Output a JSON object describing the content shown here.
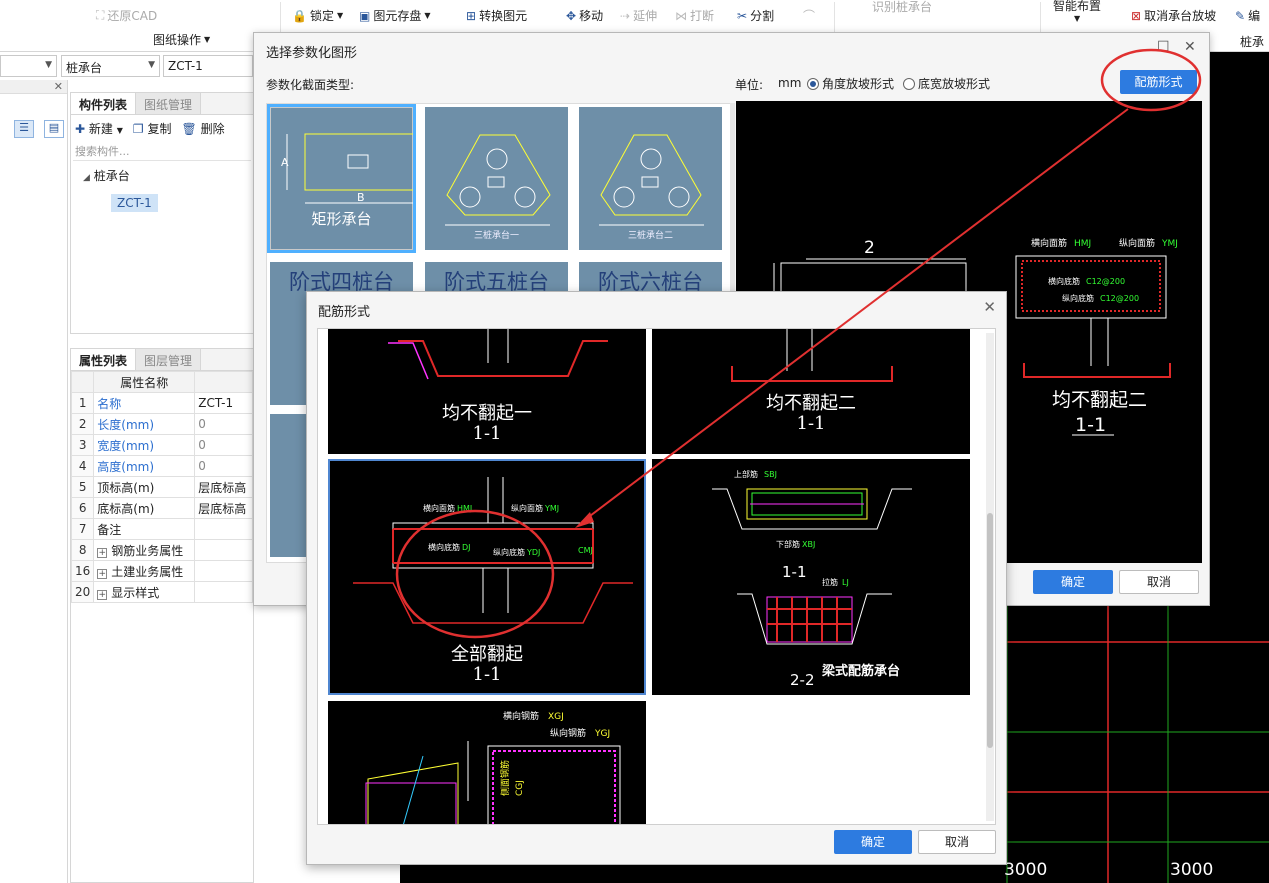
{
  "ribbon": {
    "restore_cad": "还原CAD",
    "drawing_ops": "图纸操作",
    "lock": "锁定",
    "element_save": "图元存盘",
    "convert_element": "转换图元",
    "move": "移动",
    "extend": "延伸",
    "break": "打断",
    "split": "分割",
    "identify_pile_cap": "识别桩承台",
    "smart_layout": "智能布置",
    "cancel_slope": "取消承台放坡",
    "edit": "编",
    "pile_cap_group": "桩承"
  },
  "selectors": {
    "sel1": "",
    "sel2": "桩承台",
    "sel3": "ZCT-1"
  },
  "component_panel": {
    "tab_list": "构件列表",
    "tab_drawing": "图纸管理",
    "new": "新建",
    "copy": "复制",
    "delete": "删除",
    "search_placeholder": "搜索构件...",
    "tree_root": "桩承台",
    "tree_child": "ZCT-1"
  },
  "property_panel": {
    "tab_props": "属性列表",
    "tab_layers": "图层管理",
    "header": "属性名称",
    "rows": [
      {
        "num": "1",
        "name": "名称",
        "value": "ZCT-1"
      },
      {
        "num": "2",
        "name": "长度(mm)",
        "value": "0"
      },
      {
        "num": "3",
        "name": "宽度(mm)",
        "value": "0"
      },
      {
        "num": "4",
        "name": "高度(mm)",
        "value": "0"
      },
      {
        "num": "5",
        "name": "顶标高(m)",
        "value": "层底标高"
      },
      {
        "num": "6",
        "name": "底标高(m)",
        "value": "层底标高"
      },
      {
        "num": "7",
        "name": "备注",
        "value": ""
      },
      {
        "num": "8",
        "name": "钢筋业务属性",
        "value": ""
      },
      {
        "num": "16",
        "name": "土建业务属性",
        "value": ""
      },
      {
        "num": "20",
        "name": "显示样式",
        "value": ""
      }
    ]
  },
  "cad": {
    "dim1": "3000",
    "dim2": "3000"
  },
  "dialog1": {
    "title": "选择参数化图形",
    "section_type_label": "参数化截面类型:",
    "unit_label": "单位:",
    "unit": "mm",
    "radio_angle": "角度放坡形式",
    "radio_width": "底宽放坡形式",
    "rebar_btn": "配筋形式",
    "ok": "确定",
    "cancel": "取消",
    "thumbs": [
      {
        "caption": "矩形承台"
      },
      {
        "caption": "三桩承台一"
      },
      {
        "caption": "三桩承台二"
      },
      {
        "caption": "阶式四桩台"
      },
      {
        "caption": "阶式五桩台"
      },
      {
        "caption": "阶式六桩台"
      }
    ],
    "preview": {
      "section_num": "2",
      "label_top_rebar": "横向面筋",
      "label_top_rebar_code": "HMJ",
      "label_long_rebar": "纵向面筋",
      "label_long_rebar_code": "YMJ",
      "label_bottom": "横向底筋",
      "label_bottom_spec": "C12@200",
      "label_long_bottom": "纵向底筋",
      "label_long_bottom_spec": "C12@200",
      "caption": "均不翻起二",
      "section": "1-1"
    }
  },
  "dialog2": {
    "title": "配筋形式",
    "ok": "确定",
    "cancel": "取消",
    "options": [
      {
        "caption": "均不翻起一",
        "section": "1-1"
      },
      {
        "caption": "均不翻起二",
        "section": "1-1"
      },
      {
        "caption": "全部翻起",
        "section": "1-1"
      },
      {
        "caption": "梁式配筋承台",
        "section": "1-1",
        "section2": "2-2"
      },
      {
        "caption": ""
      }
    ],
    "opt3_labels": {
      "top": "横向面筋",
      "top_code": "HMJ",
      "long": "纵向面筋",
      "long_code": "YMJ",
      "bottom": "横向底筋",
      "bottom_code": "DJ",
      "long_bottom": "纵向底筋",
      "long_bottom_code": "YDJ",
      "side": "CMJ"
    },
    "opt4_labels": {
      "top": "上部筋",
      "top_code": "SBJ",
      "bottom": "下部筋",
      "bottom_code": "XBJ",
      "lap": "拉筋",
      "lap_code": "LJ"
    },
    "opt5_labels": {
      "h": "横向钢筋",
      "h_code": "XGJ",
      "v": "纵向钢筋",
      "v_code": "YGJ",
      "side": "侧面钢筋",
      "side_code": "CGJ"
    }
  },
  "colors": {
    "accent": "#2d7be0",
    "annotation_red": "#e03030"
  }
}
